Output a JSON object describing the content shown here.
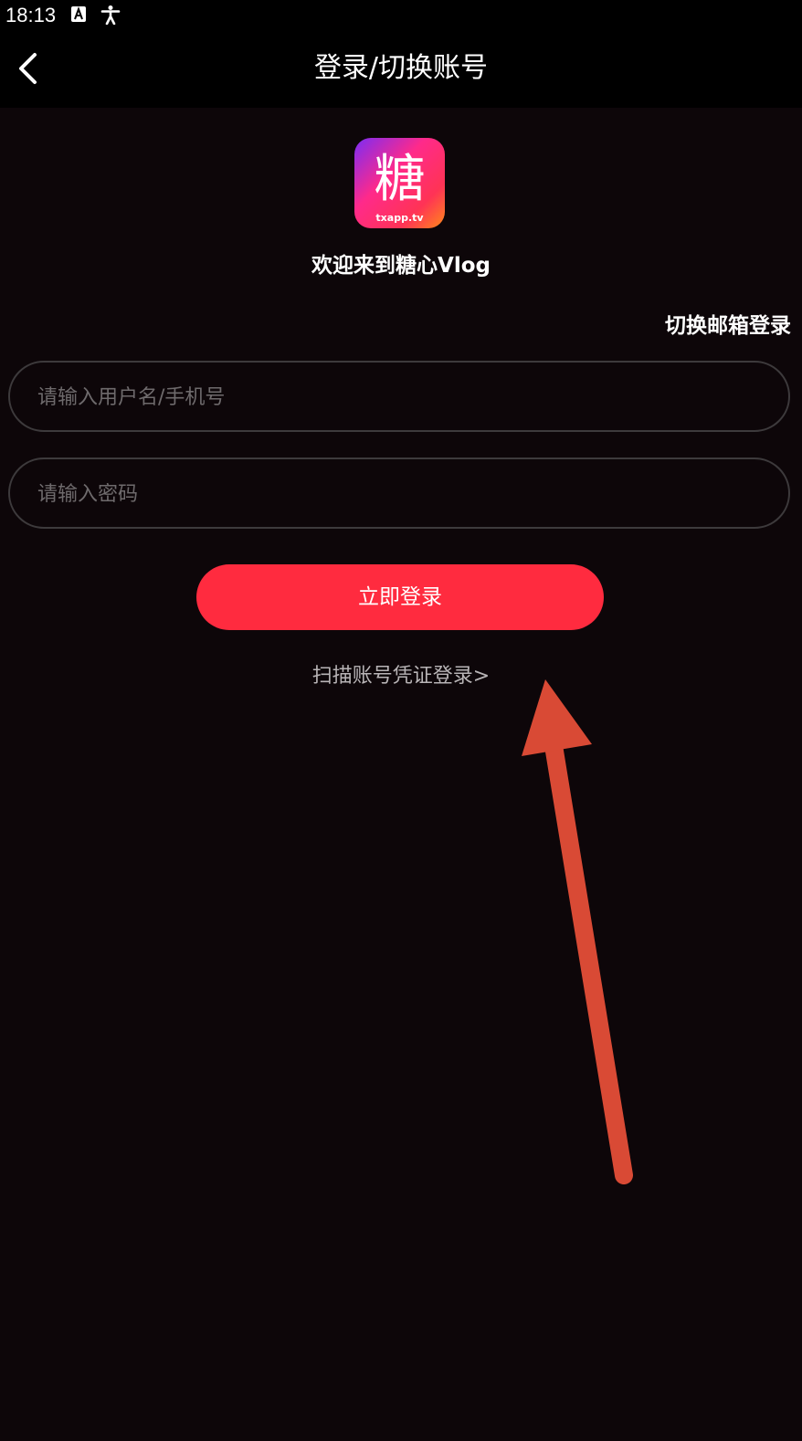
{
  "status_bar": {
    "time": "18:13",
    "icons": [
      "keyboard-a-icon",
      "accessibility-icon"
    ]
  },
  "nav": {
    "title": "登录/切换账号",
    "back_icon": "chevron-left-icon"
  },
  "logo": {
    "glyph": "糖",
    "caption": "txapp.tv"
  },
  "welcome": "欢迎来到糖心Vlog",
  "switch_email_label": "切换邮箱登录",
  "form": {
    "username_placeholder": "请输入用户名/手机号",
    "password_placeholder": "请输入密码",
    "login_label": "立即登录",
    "scan_link": "扫描账号凭证登录>"
  },
  "colors": {
    "background": "#0d0609",
    "primary": "#ff2b3f",
    "annotation_arrow": "#d94a35"
  }
}
